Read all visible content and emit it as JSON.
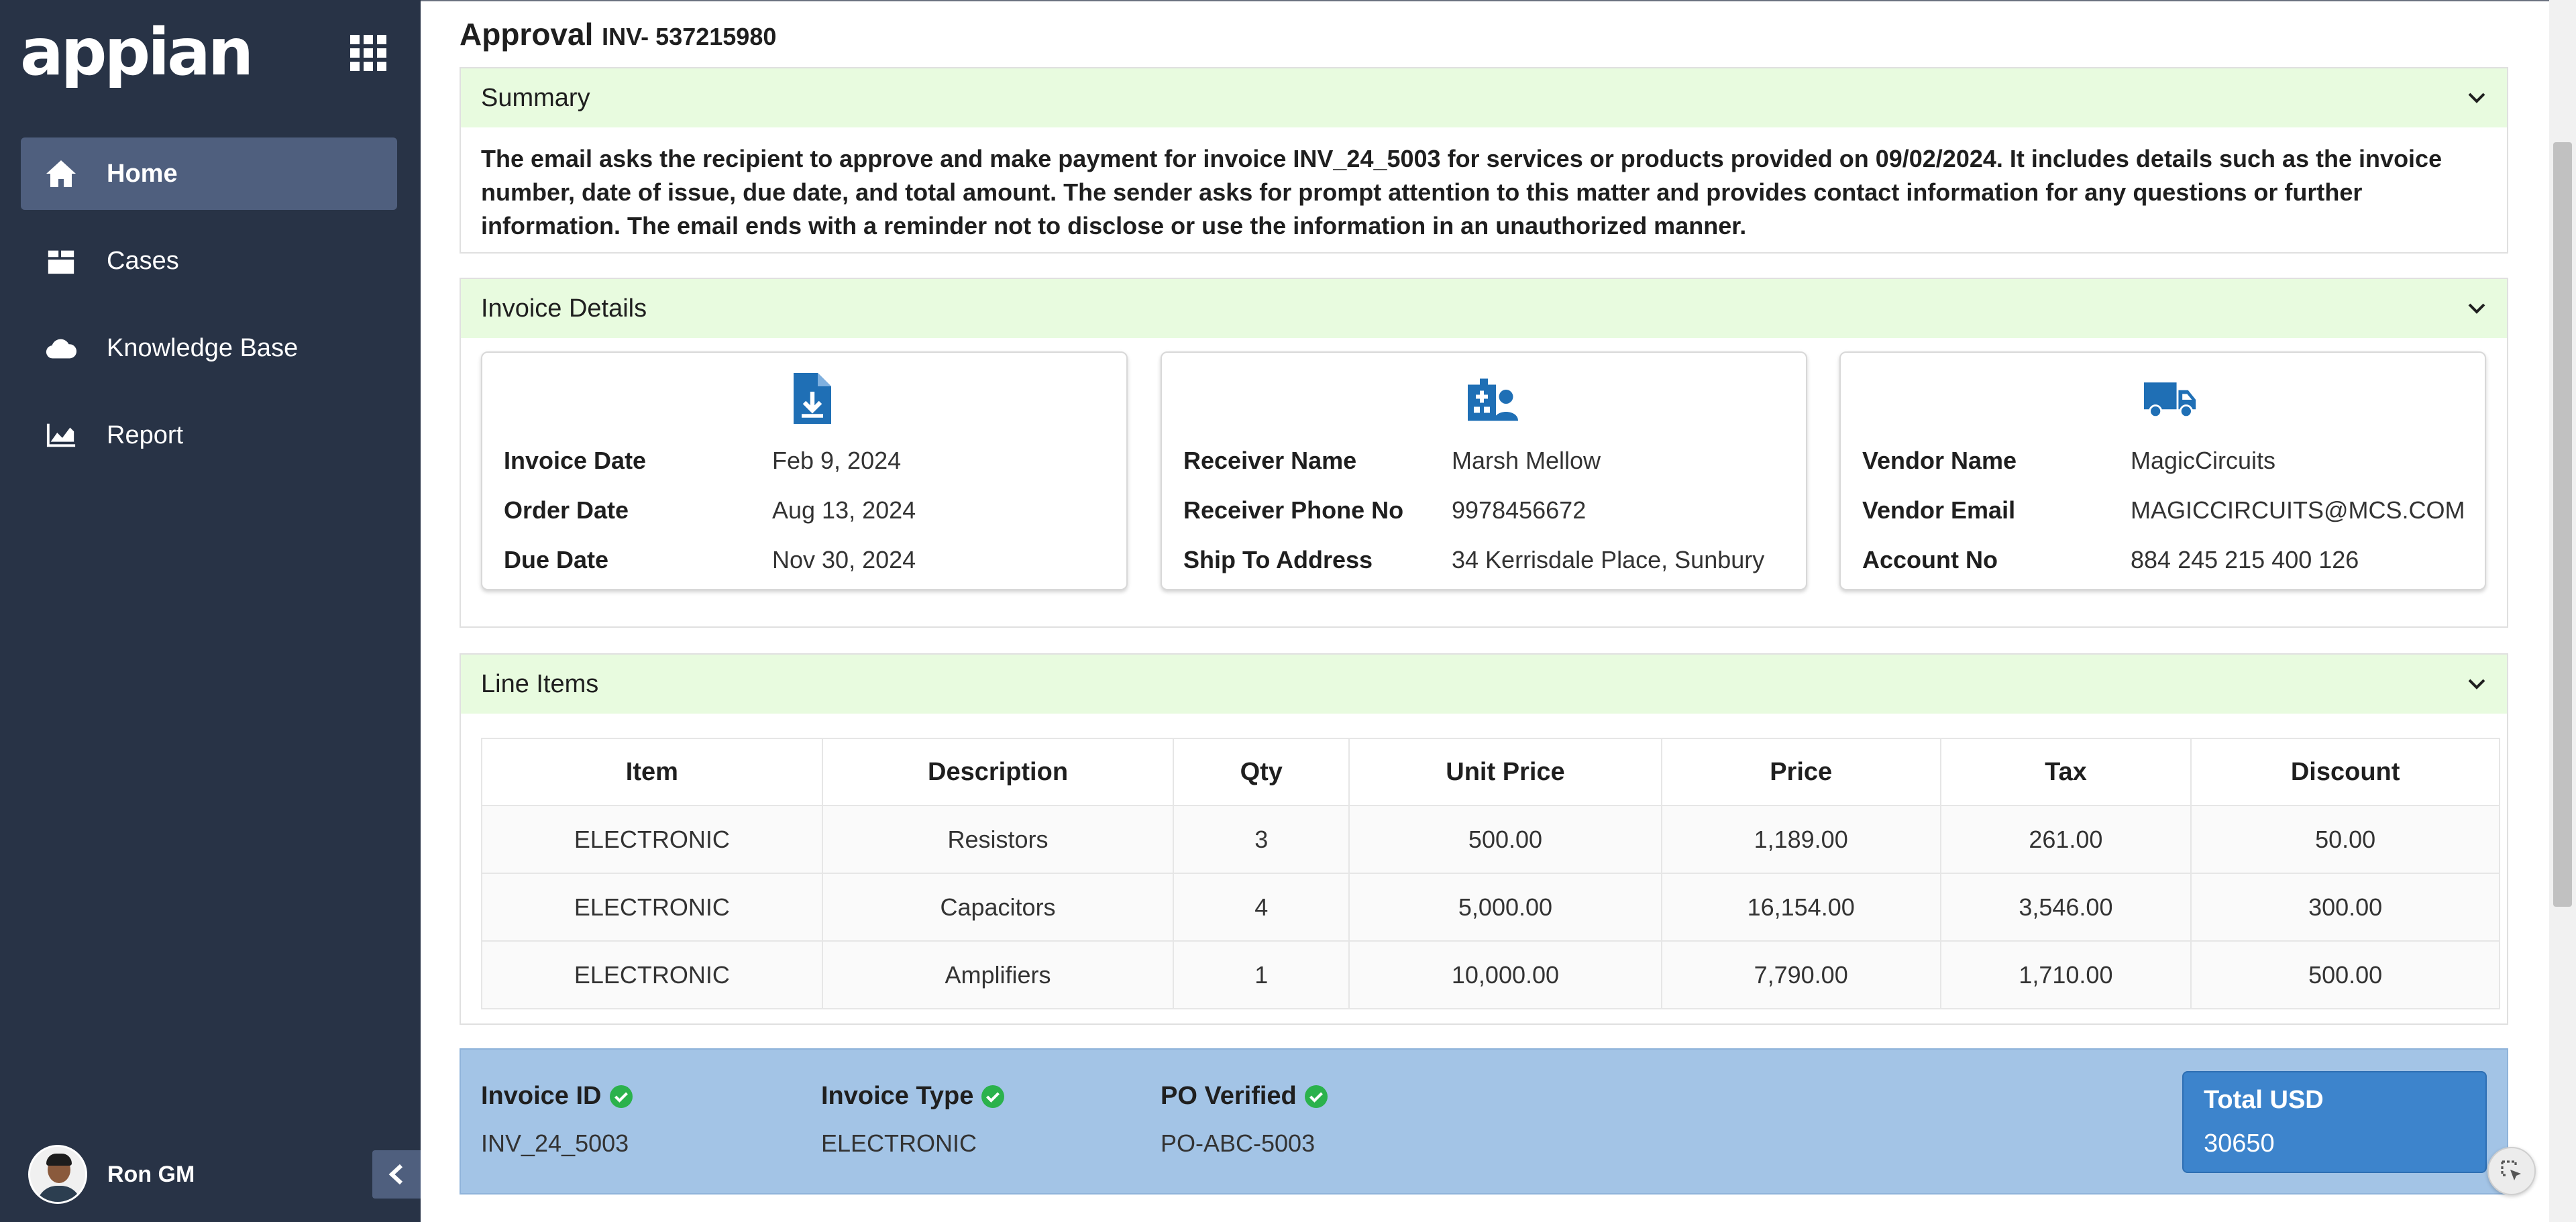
{
  "app": {
    "logo": "appian"
  },
  "sidebar": {
    "items": [
      {
        "label": "Home",
        "icon": "home-icon",
        "active": true
      },
      {
        "label": "Cases",
        "icon": "cases-icon",
        "active": false
      },
      {
        "label": "Knowledge Base",
        "icon": "cloud-icon",
        "active": false
      },
      {
        "label": "Report",
        "icon": "report-chart-icon",
        "active": false
      }
    ],
    "user": {
      "name": "Ron GM"
    }
  },
  "header": {
    "title": "Approval",
    "invoice_ref": "INV- 537215980"
  },
  "summary": {
    "title": "Summary",
    "text": "The email asks the recipient to approve and make payment for invoice INV_24_5003 for services or products provided on 09/02/2024. It includes details such as the invoice number, date of issue, due date, and total amount. The sender asks for prompt attention to this matter and provides contact information for any questions or further information. The email ends with a reminder not to disclose or use the information in an unauthorized manner."
  },
  "invoice_details": {
    "title": "Invoice Details",
    "cards": [
      {
        "icon": "document-download-icon",
        "rows": [
          {
            "label": "Invoice Date",
            "value": "Feb 9, 2024"
          },
          {
            "label": "Order Date",
            "value": "Aug 13, 2024"
          },
          {
            "label": "Due Date",
            "value": "Nov 30, 2024"
          }
        ]
      },
      {
        "icon": "hospital-user-icon",
        "rows": [
          {
            "label": "Receiver Name",
            "value": "Marsh Mellow"
          },
          {
            "label": "Receiver Phone No",
            "value": "9978456672"
          },
          {
            "label": "Ship To Address",
            "value": "34 Kerrisdale Place, Sunbury"
          }
        ]
      },
      {
        "icon": "truck-icon",
        "rows": [
          {
            "label": "Vendor Name",
            "value": "MagicCircuits"
          },
          {
            "label": "Vendor Email",
            "value": "MAGICCIRCUITS@MCS.COM"
          },
          {
            "label": "Account No",
            "value": "884 245 215 400 126"
          }
        ]
      }
    ]
  },
  "line_items": {
    "title": "Line Items",
    "columns": [
      "Item",
      "Description",
      "Qty",
      "Unit Price",
      "Price",
      "Tax",
      "Discount"
    ],
    "rows": [
      [
        "ELECTRONIC",
        "Resistors",
        "3",
        "500.00",
        "1,189.00",
        "261.00",
        "50.00"
      ],
      [
        "ELECTRONIC",
        "Capacitors",
        "4",
        "5,000.00",
        "16,154.00",
        "3,546.00",
        "300.00"
      ],
      [
        "ELECTRONIC",
        "Amplifiers",
        "1",
        "10,000.00",
        "7,790.00",
        "1,710.00",
        "500.00"
      ]
    ]
  },
  "footer": {
    "invoice_id_label": "Invoice ID",
    "invoice_id": "INV_24_5003",
    "invoice_type_label": "Invoice Type",
    "invoice_type": "ELECTRONIC",
    "po_verified_label": "PO Verified",
    "po_verified": "PO-ABC-5003",
    "total_label": "Total USD",
    "total_value": "30650"
  },
  "colors": {
    "sidebar_bg": "#283346",
    "nav_active": "#4f5f7e",
    "section_header": "#e8fbdf",
    "footer_bg": "#a3c4e6",
    "total_box": "#3d84cc",
    "icon_blue": "#1f6fb5",
    "check_green": "#2bb24c"
  }
}
